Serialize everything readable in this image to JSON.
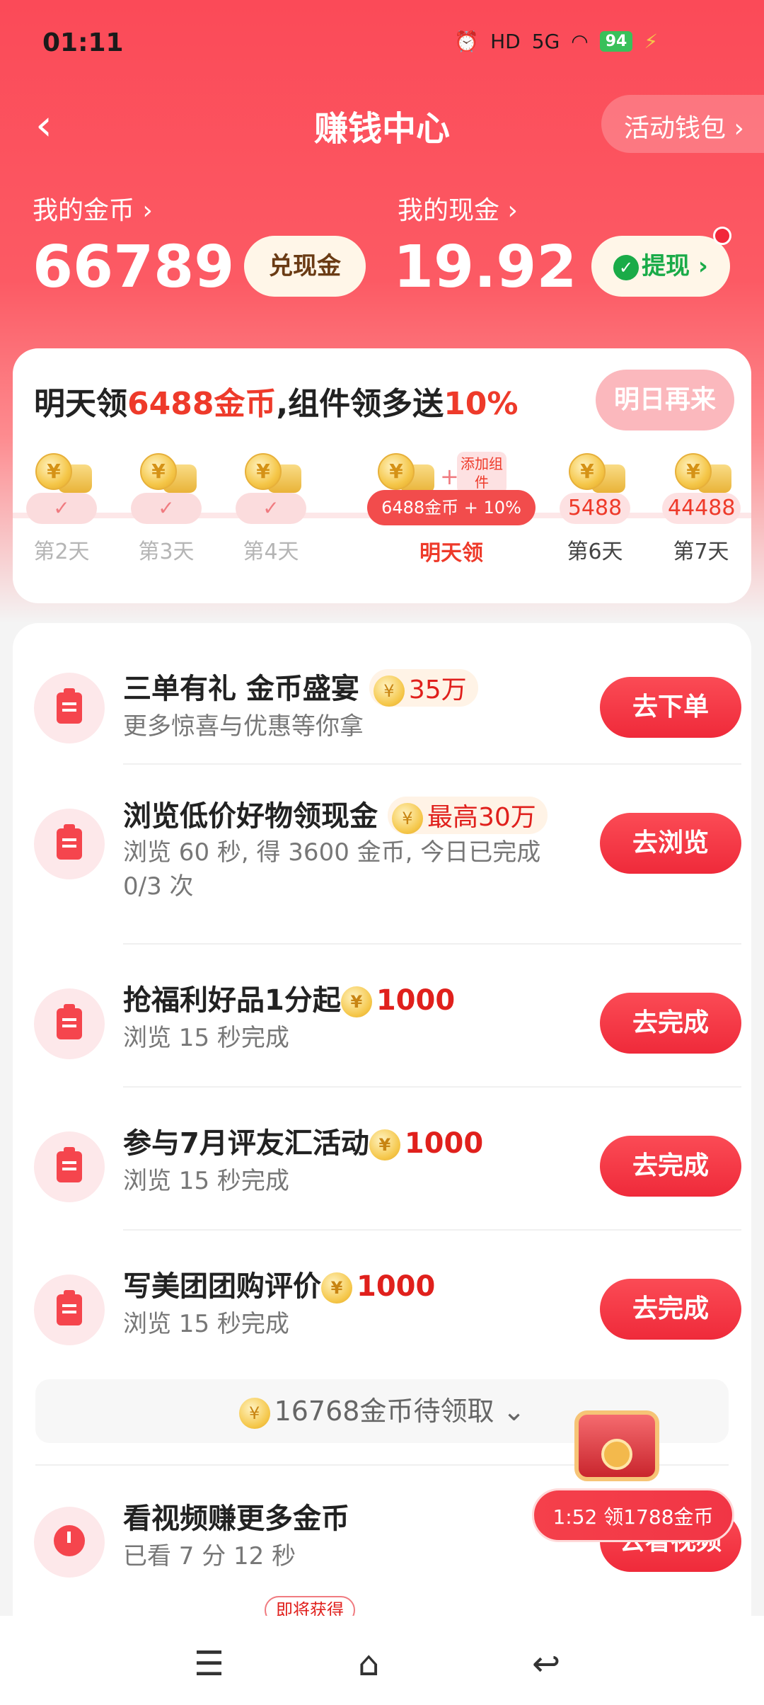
{
  "status_bar": {
    "time": "01:11",
    "hd": "HD",
    "network": "5G",
    "battery": "94"
  },
  "nav": {
    "title": "赚钱中心",
    "wallet_button": "活动钱包 ›"
  },
  "wallet": {
    "coins_label": "我的金币 ›",
    "coins_value": "66789",
    "exchange_button": "兑现金",
    "cash_label": "我的现金 ›",
    "cash_value": "19.92",
    "withdraw_button": "提现 ›"
  },
  "checkin": {
    "title_part1": "明天领",
    "title_highlight1": "6488金币",
    "title_part2": ",组件领多送",
    "title_highlight2": "10%",
    "tomorrow_button": "明日再来",
    "widget_tag": "添加组件",
    "plus": "+",
    "days": [
      {
        "label": "第2天",
        "status": "✓"
      },
      {
        "label": "第3天",
        "status": "✓"
      },
      {
        "label": "第4天",
        "status": "✓"
      },
      {
        "label": "明天领",
        "pill": "6488金币 + 10%"
      },
      {
        "label": "第6天",
        "value": "5488"
      },
      {
        "label": "第7天",
        "value": "44488"
      }
    ]
  },
  "tasks": [
    {
      "title": "三单有礼 金币盛宴",
      "reward": "35万",
      "subtitle": "更多惊喜与优惠等你拿",
      "button": "去下单"
    },
    {
      "title": "浏览低价好物领现金",
      "reward": "最高30万",
      "subtitle": "浏览 60 秒, 得 3600 金币, 今日已完成 0/3 次",
      "button": "去浏览"
    },
    {
      "title": "抢福利好品1分起",
      "reward": "1000",
      "subtitle": "浏览 15 秒完成",
      "button": "去完成"
    },
    {
      "title": "参与7月评友汇活动",
      "reward": "1000",
      "subtitle": "浏览 15 秒完成",
      "button": "去完成"
    },
    {
      "title": "写美团团购评价",
      "reward": "1000",
      "subtitle": "浏览 15 秒完成",
      "button": "去完成"
    }
  ],
  "pending": {
    "text": "16768金币待领取",
    "chevron": "⌄"
  },
  "video_task": {
    "title": "看视频赚更多金币",
    "subtitle": "已看 7 分 12 秒",
    "button": "去看视频"
  },
  "float": {
    "timer": "1:52 领1788金币",
    "soon_tag": "即将获得"
  },
  "coin_symbol": "¥"
}
